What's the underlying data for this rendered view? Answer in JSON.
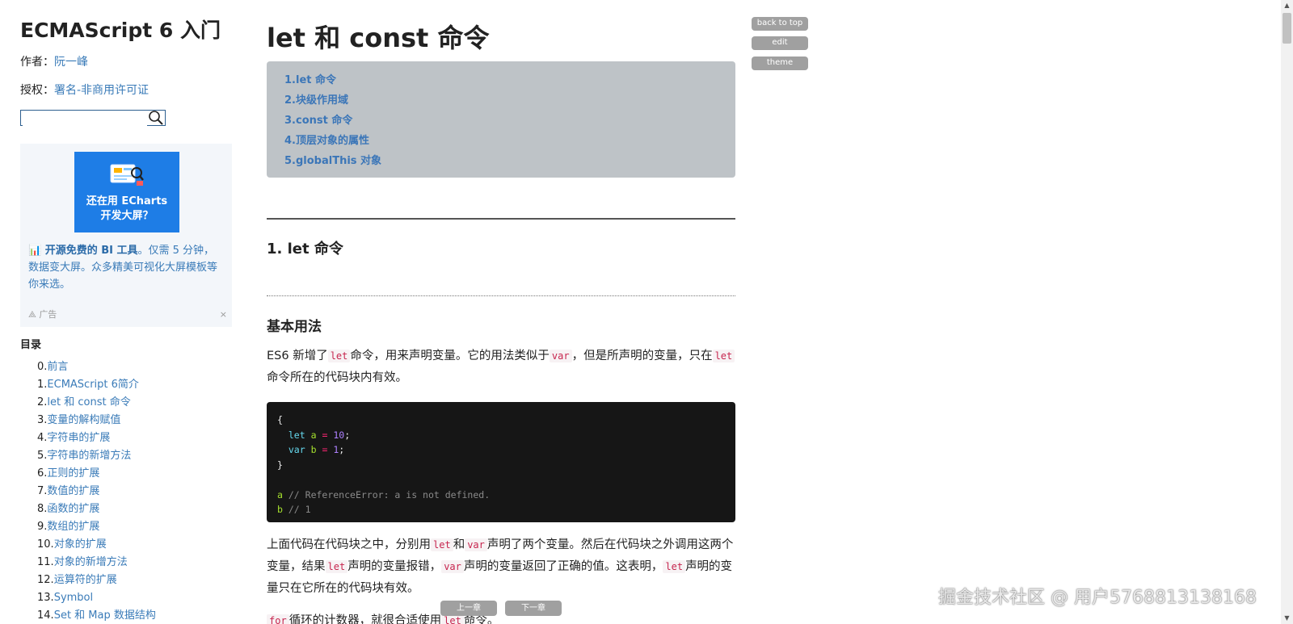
{
  "sidebar": {
    "title": "ECMAScript 6 入门",
    "author_label": "作者：",
    "author_name": "阮一峰",
    "license_label": "授权：",
    "license_name": "署名-非商用许可证",
    "search": {
      "value": "",
      "placeholder": ""
    },
    "ad": {
      "banner_line1": "还在用 ECharts",
      "banner_line2": "开发大屏？",
      "text_bold": "📊 开源免费的 BI 工具",
      "text_rest": "。仅需 5 分钟，数据变大屏。众多精美可视化大屏模板等你来选。",
      "footer": "广告",
      "close": "×"
    },
    "toc_heading": "目录",
    "toc": [
      {
        "num": "0.",
        "label": "前言"
      },
      {
        "num": "1.",
        "label": "ECMAScript 6简介"
      },
      {
        "num": "2.",
        "label": "let 和 const 命令"
      },
      {
        "num": "3.",
        "label": "变量的解构赋值"
      },
      {
        "num": "4.",
        "label": "字符串的扩展"
      },
      {
        "num": "5.",
        "label": "字符串的新增方法"
      },
      {
        "num": "6.",
        "label": "正则的扩展"
      },
      {
        "num": "7.",
        "label": "数值的扩展"
      },
      {
        "num": "8.",
        "label": "函数的扩展"
      },
      {
        "num": "9.",
        "label": "数组的扩展"
      },
      {
        "num": "10.",
        "label": "对象的扩展"
      },
      {
        "num": "11.",
        "label": "对象的新增方法"
      },
      {
        "num": "12.",
        "label": "运算符的扩展"
      },
      {
        "num": "13.",
        "label": "Symbol"
      },
      {
        "num": "14.",
        "label": "Set 和 Map 数据结构"
      }
    ]
  },
  "content": {
    "title": "let 和 const 命令",
    "toc": [
      "1.let 命令",
      "2.块级作用域",
      "3.const 命令",
      "4.顶层对象的属性",
      "5.globalThis 对象"
    ],
    "section_heading": "1. let 命令",
    "subsection_heading": "基本用法",
    "para1": {
      "t1": "ES6 新增了",
      "c1": "let",
      "t2": "命令，用来声明变量。它的用法类似于",
      "c2": "var",
      "t3": "，但是所声明的变量，只在",
      "c3": "let",
      "t4": "命令所在的代码块内有效。"
    },
    "code": {
      "l1": "{",
      "l2_kw": "let",
      "l2_var": "a",
      "l2_op": "=",
      "l2_num": "10",
      "l2_end": ";",
      "l3_kw": "var",
      "l3_var": "b",
      "l3_op": "=",
      "l3_num": "1",
      "l3_end": ";",
      "l4": "}",
      "l6_var": "a",
      "l6_cmt": "// ReferenceError: a is not defined.",
      "l7_var": "b",
      "l7_cmt": "// 1"
    },
    "para2": {
      "t1": "上面代码在代码块之中，分别用",
      "c1": "let",
      "t2": "和",
      "c2": "var",
      "t3": "声明了两个变量。然后在代码块之外调用这两个变量，结果",
      "c3": "let",
      "t4": "声明的变量报错，",
      "c4": "var",
      "t5": "声明的变量返回了正确的值。这表明，",
      "c5": "let",
      "t6": "声明的变量只在它所在的代码块有效。"
    },
    "para3": {
      "c1": "for",
      "t1": "循环的计数器，就很合适使用",
      "c2": "let",
      "t2": "命令。"
    }
  },
  "buttons": {
    "back_to_top": "back to top",
    "edit": "edit",
    "theme": "theme",
    "prev": "上一章",
    "next": "下一章"
  },
  "watermark": "掘金技术社区 @ 用户5768813138168"
}
